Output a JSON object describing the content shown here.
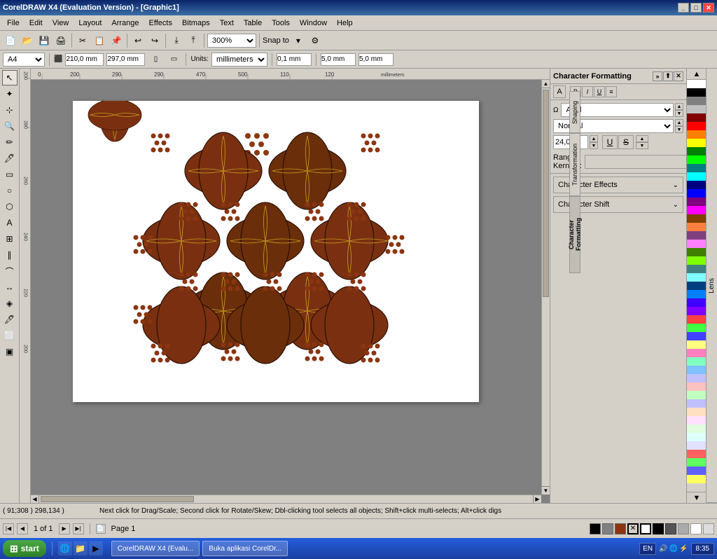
{
  "app": {
    "title": "CorelDRAW X4 (Evaluation Version) - [Graphic1]",
    "window_controls": [
      "_",
      "□",
      "✕"
    ]
  },
  "menu": {
    "items": [
      "File",
      "Edit",
      "View",
      "Layout",
      "Arrange",
      "Effects",
      "Bitmaps",
      "Text",
      "Table",
      "Tools",
      "Window",
      "Help"
    ]
  },
  "toolbar": {
    "zoom_value": "300%",
    "snap_label": "Snap to",
    "page_size": "A4",
    "width": "210,0 mm",
    "height": "297,0 mm",
    "units_label": "Units:",
    "units_value": "millimeters",
    "nudge": "0,1 mm",
    "pos_x": "5,0 mm",
    "pos_y": "5,0 mm"
  },
  "character_formatting": {
    "panel_title": "Character Formatting",
    "font_name": "Arial",
    "font_style": "Normal",
    "font_size": "24,0 pt",
    "range_kerning_label": "Range Kerning:",
    "character_effects_label": "Character Effects",
    "character_shift_label": "Character Shift",
    "character_label": "Character"
  },
  "side_tabs": {
    "shaping": "Shaping",
    "transformation": "Transformation",
    "character_formatting": "Character Formatting"
  },
  "far_right_tabs": {
    "lens": "Lens"
  },
  "page_nav": {
    "current": "1 of 1",
    "page_label": "Page 1"
  },
  "status_bar": {
    "coords": "( 91;308 ) 298,134 )",
    "message": "Next click for Drag/Scale; Second click for Rotate/Skew; Dbl-clicking tool selects all objects; Shift+click multi-selects; Alt+click digs"
  },
  "taskbar": {
    "start": "start",
    "items": [
      "CorelDRAW X4 (Evalu...",
      "Buka aplikasi CorelDr..."
    ],
    "time": "8:35",
    "tray_items": [
      "EN"
    ]
  },
  "colors": {
    "palette": [
      "#ffffff",
      "#000000",
      "#808080",
      "#c0c0c0",
      "#800000",
      "#ff0000",
      "#ff8000",
      "#ffff00",
      "#008000",
      "#00ff00",
      "#008080",
      "#00ffff",
      "#000080",
      "#0000ff",
      "#800080",
      "#ff00ff",
      "#804000",
      "#ff8040",
      "#804080",
      "#ff80ff",
      "#408000",
      "#80ff00",
      "#408080",
      "#80ffff",
      "#004080",
      "#0080ff",
      "#4000ff",
      "#8000ff",
      "#ff4040",
      "#40ff40",
      "#4040ff",
      "#ffff80",
      "#ff80c0",
      "#80ffc0",
      "#80c0ff",
      "#c0c0ff",
      "#ffc0c0",
      "#c0ffc0",
      "#c0c0ff",
      "#ffe0c0",
      "#ffe0ff",
      "#e0ffe0",
      "#e0ffff",
      "#e0e0ff",
      "#ff6060",
      "#60ff60",
      "#6060ff",
      "#ffff60"
    ]
  }
}
